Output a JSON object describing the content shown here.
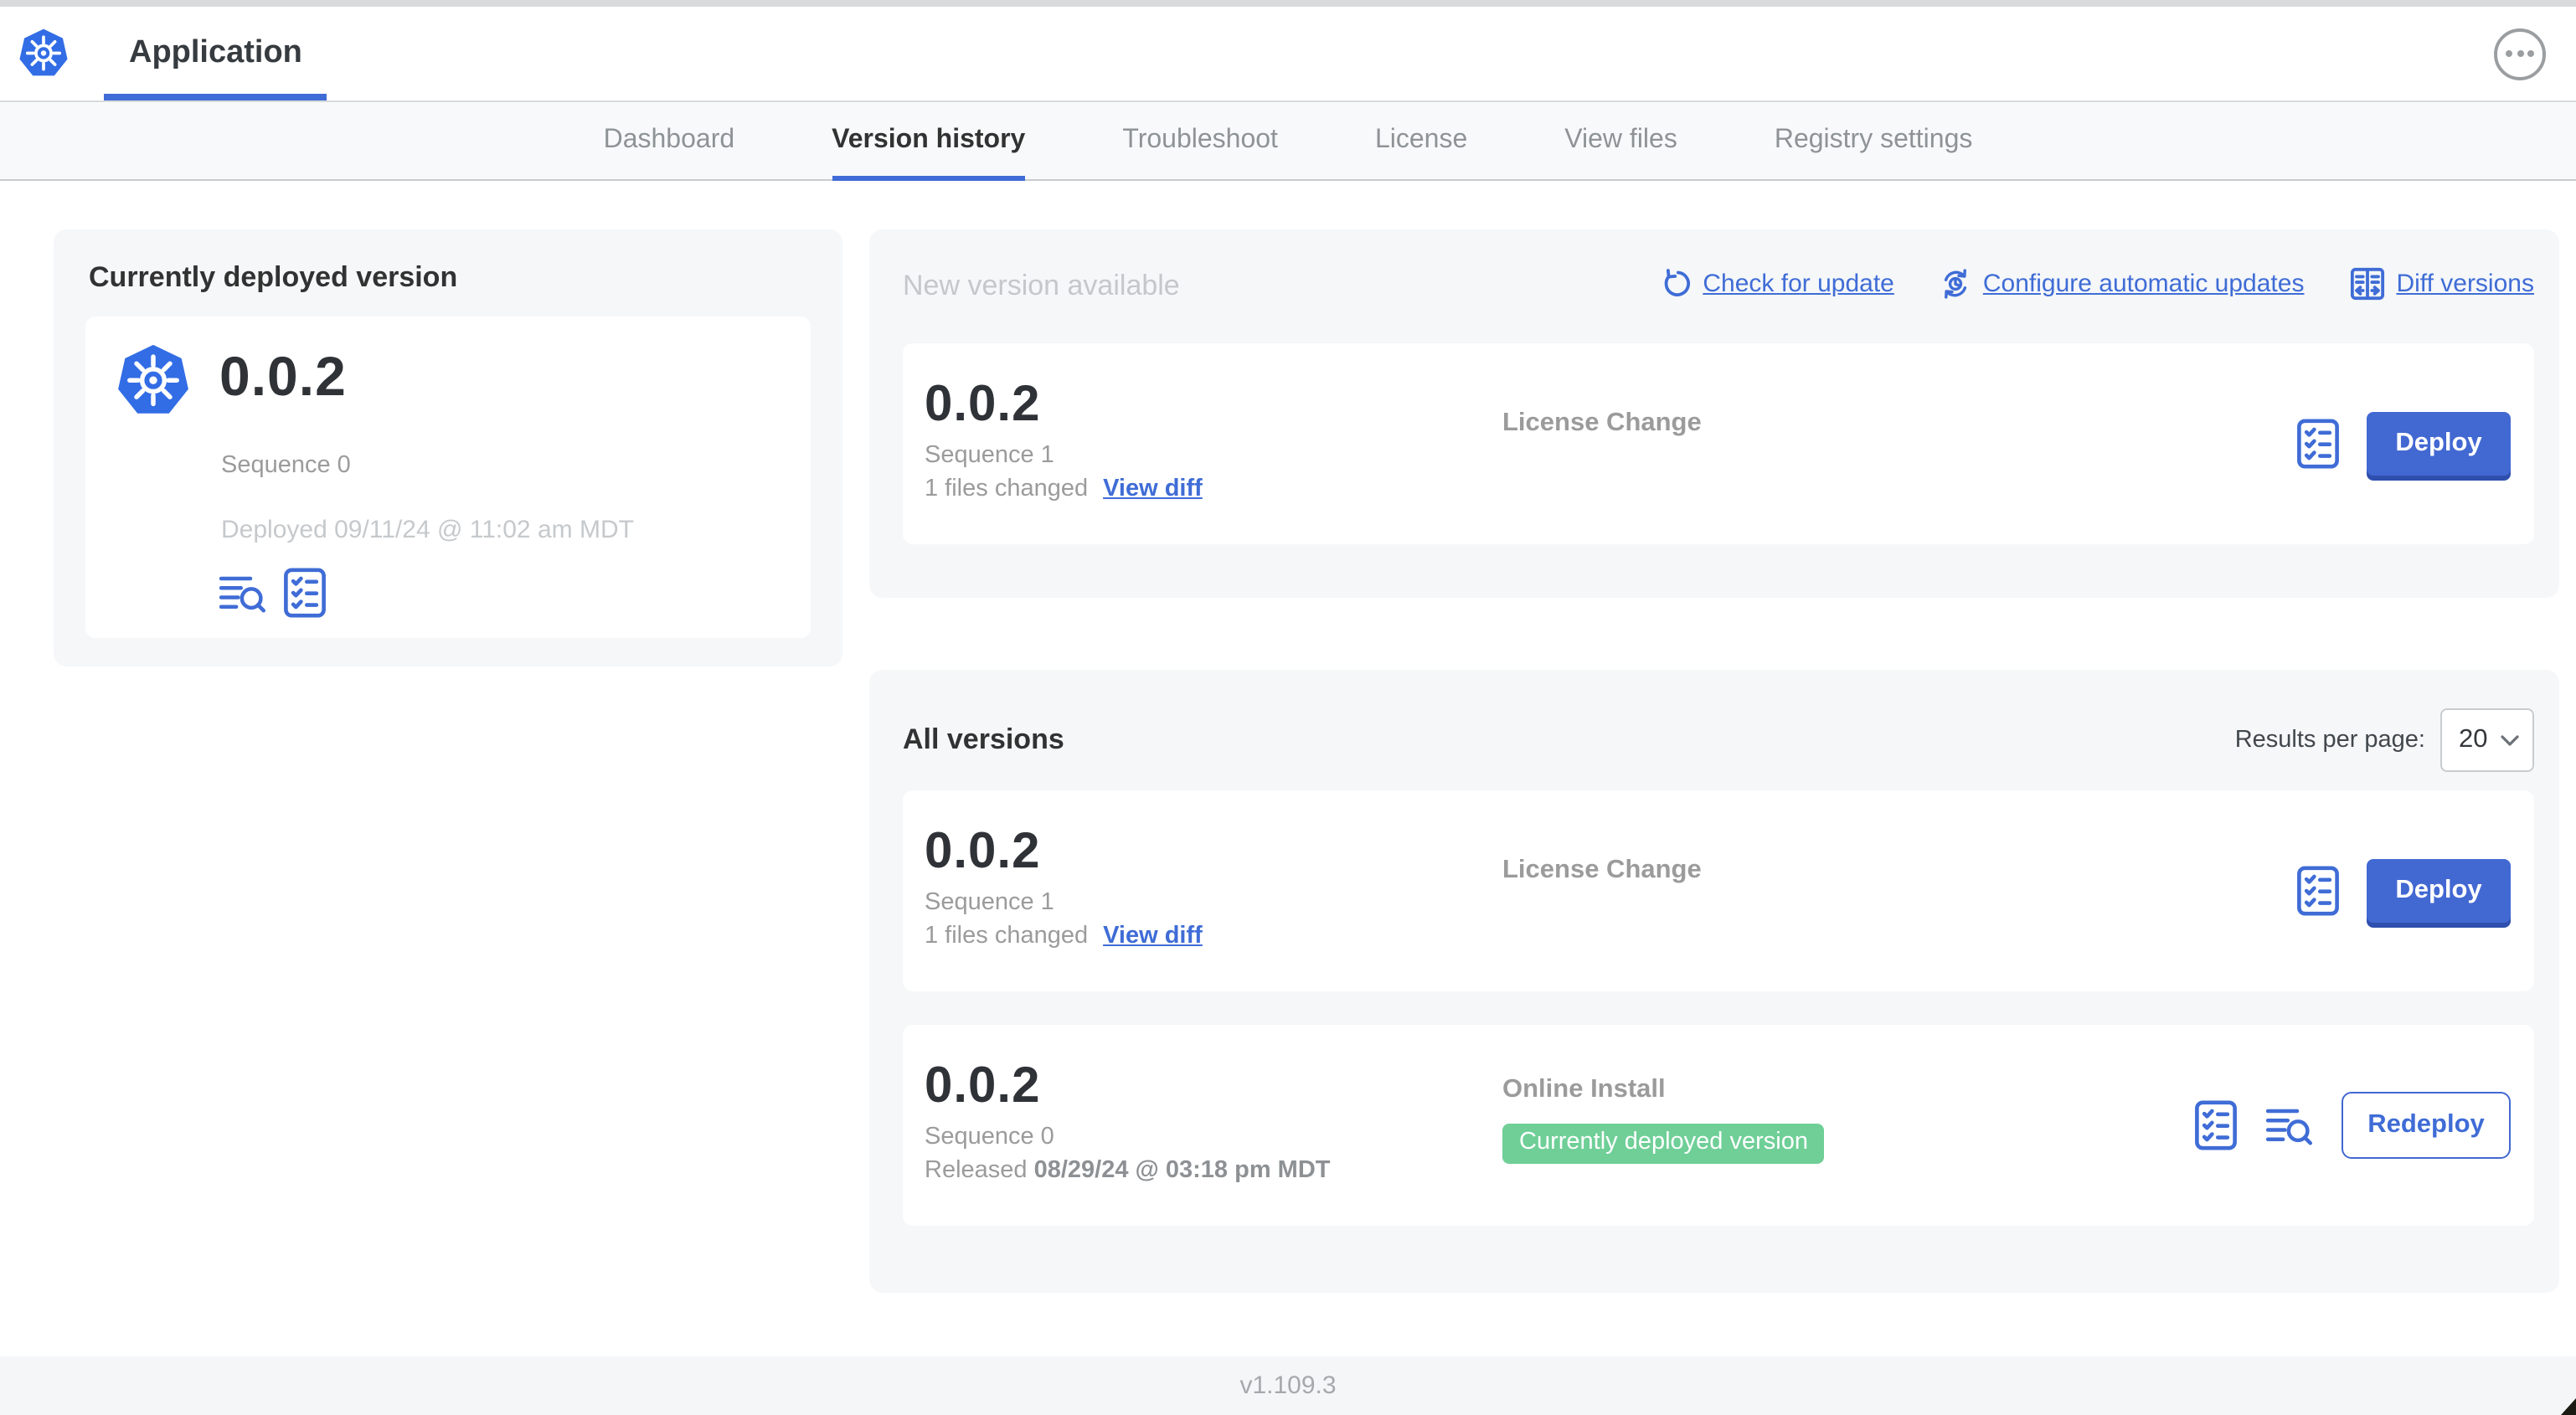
{
  "header": {
    "app_title": "Application"
  },
  "nav": {
    "tabs": [
      {
        "label": "Dashboard",
        "active": false
      },
      {
        "label": "Version history",
        "active": true
      },
      {
        "label": "Troubleshoot",
        "active": false
      },
      {
        "label": "License",
        "active": false
      },
      {
        "label": "View files",
        "active": false
      },
      {
        "label": "Registry settings",
        "active": false
      }
    ]
  },
  "current_version": {
    "title": "Currently deployed version",
    "version": "0.0.2",
    "sequence": "Sequence 0",
    "deployed_at": "Deployed 09/11/24 @ 11:02 am MDT"
  },
  "new_version": {
    "title": "New version available",
    "links": {
      "check_for_update": "Check for update",
      "configure_automatic_updates": "Configure automatic updates",
      "diff_versions": "Diff versions"
    },
    "card": {
      "version": "0.0.2",
      "sequence": "Sequence 1",
      "files_changed": "1 files changed",
      "view_diff": "View diff",
      "release_notes": "License Change",
      "action_label": "Deploy"
    }
  },
  "all_versions": {
    "title": "All versions",
    "results_per_page_label": "Results per page:",
    "results_per_page_value": "20",
    "rows": [
      {
        "version": "0.0.2",
        "sequence": "Sequence 1",
        "files_changed": "1 files changed",
        "view_diff": "View diff",
        "release_notes": "License Change",
        "action_label": "Deploy"
      },
      {
        "version": "0.0.2",
        "sequence": "Sequence 0",
        "released_prefix": "Released ",
        "released_date": "08/29/24 @ 03:18 pm MDT",
        "install_type": "Online Install",
        "badge": "Currently deployed version",
        "action_label": "Redeploy"
      }
    ]
  },
  "footer": {
    "app_version": "v1.109.3"
  },
  "colors": {
    "accent_blue": "#3f6cd6",
    "button_blue": "#4268d2",
    "kubernetes_blue": "#326de6",
    "badge_green": "#6fcf97",
    "panel_gray": "#f5f7f9",
    "text_dark": "#323232",
    "text_gray": "#9b9b9b",
    "text_light_gray": "#c6c9cc"
  }
}
